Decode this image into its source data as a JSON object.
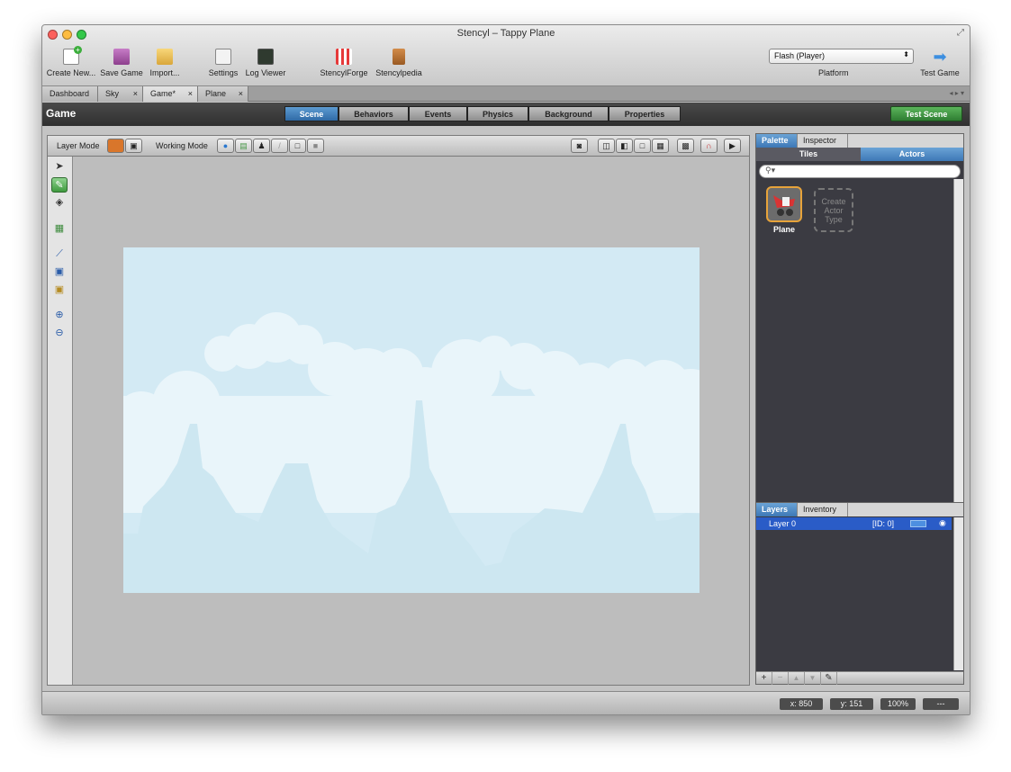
{
  "window": {
    "title": "Stencyl – Tappy Plane"
  },
  "toolbar": {
    "items": [
      {
        "label": "Create New...",
        "icon": "create-new-icon"
      },
      {
        "label": "Save Game",
        "icon": "save-icon"
      },
      {
        "label": "Import...",
        "icon": "import-icon"
      },
      {
        "label": "Settings",
        "icon": "settings-icon"
      },
      {
        "label": "Log Viewer",
        "icon": "log-viewer-icon"
      },
      {
        "label": "StencylForge",
        "icon": "stencylforge-icon"
      },
      {
        "label": "Stencylpedia",
        "icon": "stencylpedia-icon"
      }
    ],
    "platform_value": "Flash (Player)",
    "platform_label": "Platform",
    "test_game_label": "Test Game"
  },
  "tabs": [
    {
      "label": "Dashboard"
    },
    {
      "label": "Sky",
      "close": "×"
    },
    {
      "label": "Game*",
      "close": "×"
    },
    {
      "label": "Plane",
      "close": "×"
    }
  ],
  "header": {
    "title": "Game",
    "segments": [
      "Scene",
      "Behaviors",
      "Events",
      "Physics",
      "Background",
      "Properties"
    ],
    "test_scene": "Test Scene"
  },
  "scene_toolbar": {
    "layer_mode": "Layer Mode",
    "working_mode": "Working Mode"
  },
  "palette": {
    "tabs": [
      "Palette",
      "Inspector"
    ],
    "subtabs": [
      "Tiles",
      "Actors"
    ],
    "actor_name": "Plane",
    "create_actor_type": "Create Actor Type"
  },
  "layers": {
    "tabs": [
      "Layers",
      "Inventory"
    ],
    "rows": [
      {
        "name": "Layer 0",
        "id": "[ID: 0]",
        "color": "#4d8fe0"
      }
    ],
    "buttons": [
      "+",
      "−",
      "▲",
      "▼"
    ]
  },
  "status": {
    "x": "x:  850",
    "y": "y:  151",
    "zoom": "100%",
    "extra": "---"
  },
  "colors": {
    "accent": "#3d78b6",
    "test_green": "#2e7d32",
    "sky": "#d3eaf4",
    "cloud": "#e9f5fa",
    "mountain": "#cde7f1"
  }
}
